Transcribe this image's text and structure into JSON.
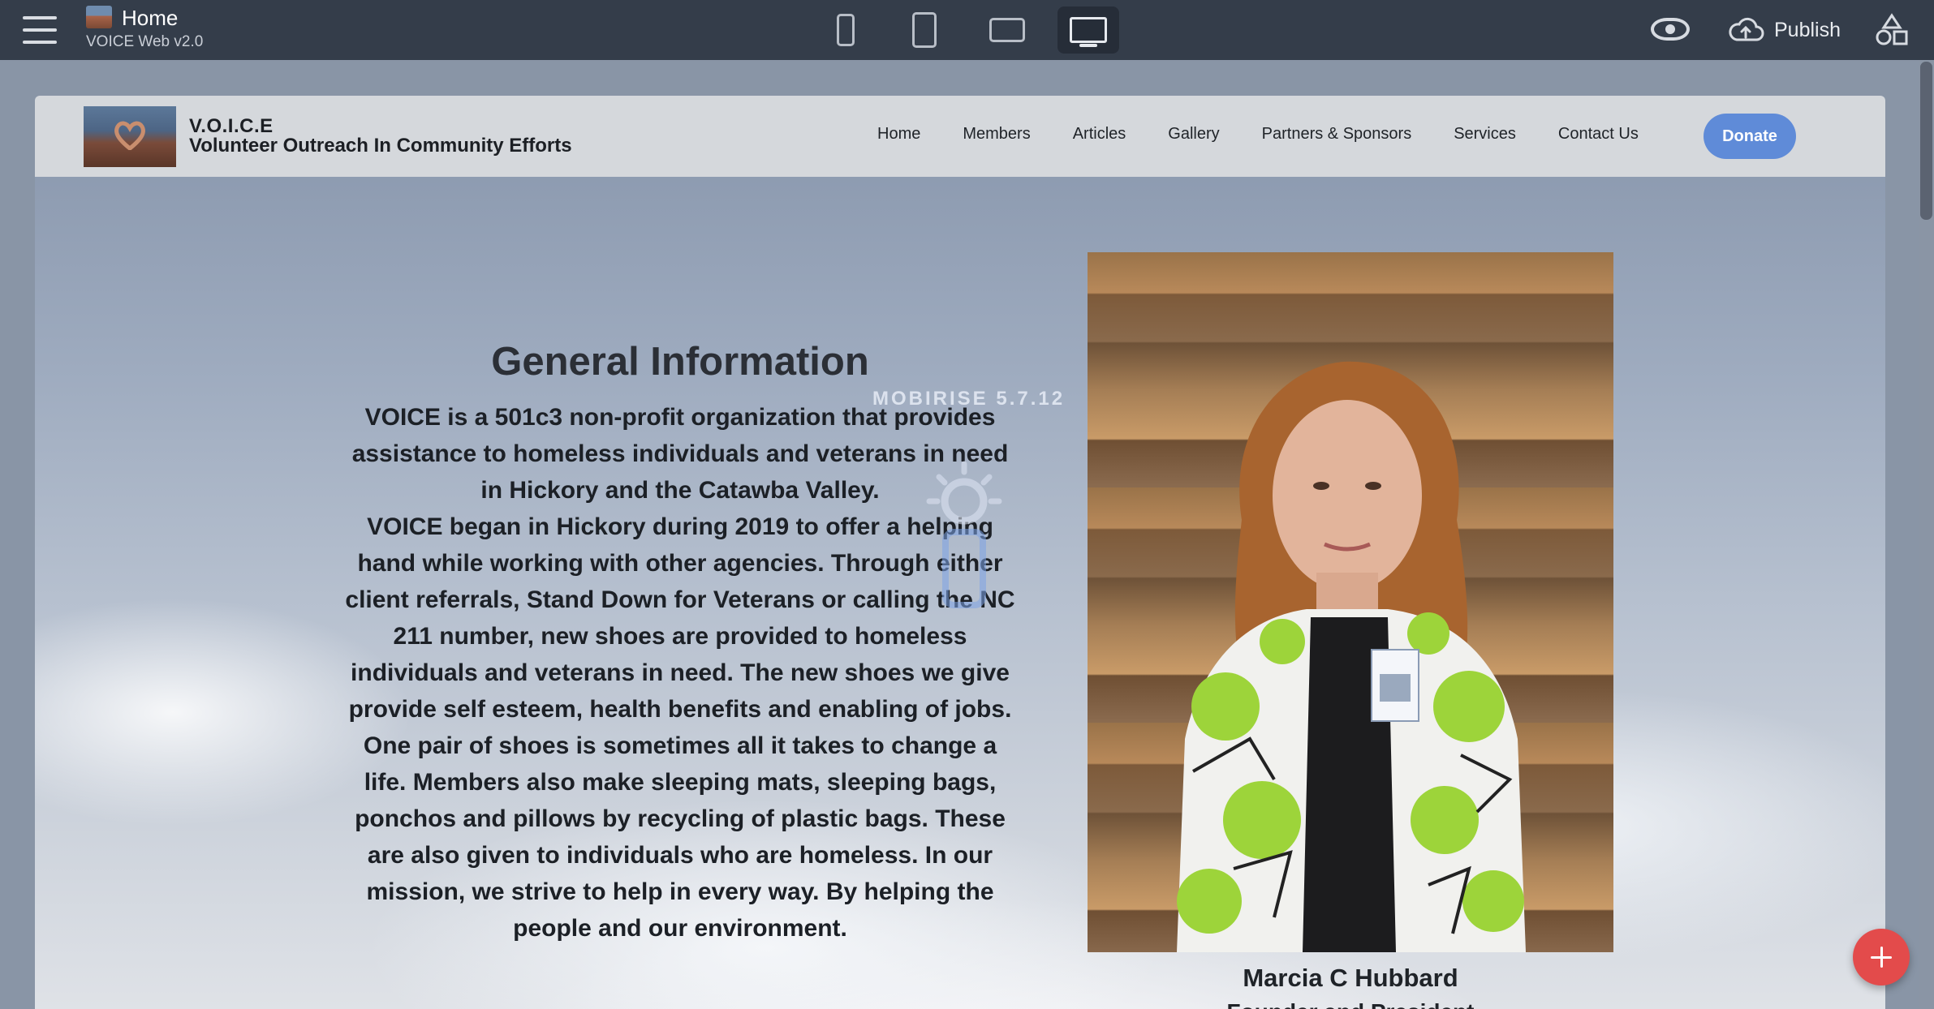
{
  "editor": {
    "page_title": "Home",
    "project_name": "VOICE Web v2.0",
    "publish_label": "Publish",
    "devices": [
      "phone",
      "tablet",
      "tablet-landscape",
      "desktop"
    ],
    "active_device": "desktop"
  },
  "site": {
    "brand_short": "V.O.I.C.E",
    "brand_long": "Volunteer Outreach In Community Efforts",
    "nav": [
      "Home",
      "Members",
      "Articles",
      "Gallery",
      "Partners & Sponsors",
      "Services",
      "Contact Us"
    ],
    "donate_label": "Donate",
    "watermark": "MOBIRISE  5.7.12",
    "section_title": "General Information",
    "paragraphs": [
      "VOICE is a 501c3 non-profit organization that provides assistance to homeless individuals and veterans in need in Hickory and the Catawba Valley.",
      "VOICE began in Hickory during 2019 to offer a helping hand while working with other agencies. Through either client referrals, Stand Down for Veterans or calling the NC 211 number, new shoes are provided to homeless individuals and veterans in need. The new shoes we give provide self esteem, health benefits and enabling of jobs. One pair of shoes is sometimes all it takes to change a life. Members also make sleeping mats, sleeping bags, ponchos and pillows by recycling of plastic bags. These are also given to individuals who are homeless. In our mission, we strive to help in every way. By helping the people and our environment."
    ],
    "person_name": "Marcia C Hubbard",
    "person_role": "Founder and President"
  },
  "colors": {
    "toolbar": "#343d4a",
    "donate": "#5f8bd8",
    "fab": "#e34b4b"
  }
}
